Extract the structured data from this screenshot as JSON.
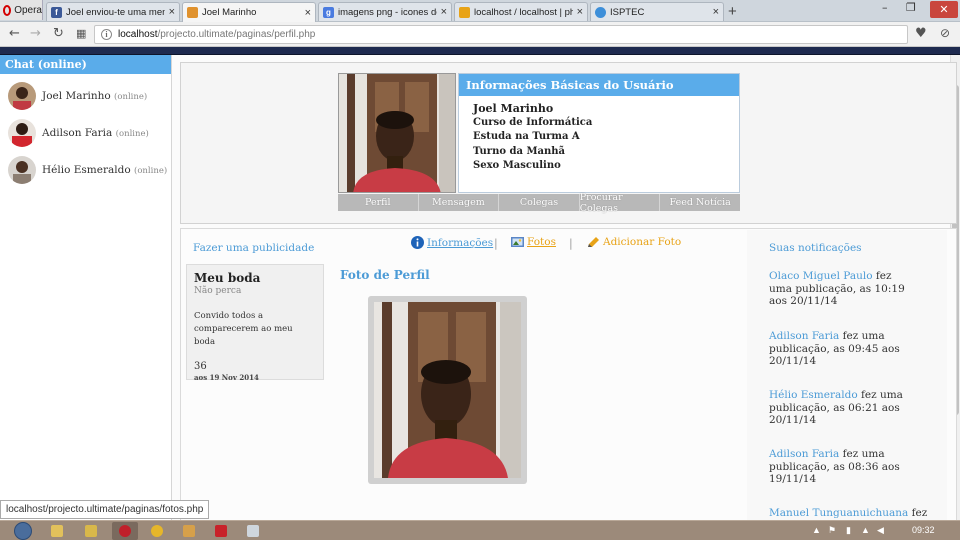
{
  "browser": {
    "menu_label": "Opera",
    "tabs": [
      {
        "label": "Joel enviou-te uma mens",
        "icon": "facebook-icon",
        "color": "#3b5998",
        "active": false
      },
      {
        "label": "Joel Marinho",
        "icon": "site-icon",
        "color": "#e0922e",
        "active": true
      },
      {
        "label": "imagens png - icones de",
        "icon": "google-icon",
        "color": "#4a7be0",
        "active": false
      },
      {
        "label": "localhost / localhost | php",
        "icon": "phpmyadmin-icon",
        "color": "#e8a317",
        "active": false
      },
      {
        "label": "ISPTEC",
        "icon": "globe-icon",
        "color": "#3d8fd9",
        "active": false
      }
    ],
    "url_host": "localhost",
    "url_path": "/projecto.ultimate/paginas/perfil.php",
    "status_url": "localhost/projecto.ultimate/paginas/fotos.php"
  },
  "chat": {
    "header": "Chat (online)",
    "users": [
      {
        "name": "Joel Marinho",
        "status": "(online)"
      },
      {
        "name": "Adilson Faria",
        "status": "(online)"
      },
      {
        "name": "Hélio Esmeraldo",
        "status": "(online)"
      }
    ]
  },
  "profile": {
    "info_title": "Informações Básicas do Usuário",
    "name": "Joel Marinho",
    "course": "Curso de Informática",
    "class": "Estuda na Turma A",
    "shift": "Turno da Manhã",
    "sex": "Sexo Masculino",
    "nav": [
      "Perfil",
      "Mensagem",
      "Colegas",
      "Procurar Colegas",
      "Feed Notícia"
    ]
  },
  "publish": {
    "link": "Fazer uma publicidade",
    "card": {
      "title": "Meu boda",
      "subtitle": "Não perca",
      "body": "Convido todos a comparecerem ao meu boda",
      "count": "36",
      "date": "aos 19 Nov 2014"
    }
  },
  "center": {
    "tabs": [
      {
        "label": "Informações",
        "icon": "info-icon",
        "color": "#4c9bd6"
      },
      {
        "label": "Fotos",
        "icon": "photos-icon",
        "color": "#e8a317"
      },
      {
        "label": "Adicionar Foto",
        "icon": "pencil-icon",
        "color": "#e8a317"
      }
    ],
    "photo_heading": "Foto de Perfil"
  },
  "notifications": {
    "header": "Suas notificações",
    "items": [
      {
        "who": "Olaco Miguel Paulo",
        "text": " fez uma publicação, as 10:19 aos 20/11/14"
      },
      {
        "who": "Adilson Faria",
        "text": " fez uma publicação, as 09:45 aos 20/11/14"
      },
      {
        "who": "Hélio Esmeraldo",
        "text": " fez uma publicação, as 06:21 aos 20/11/14"
      },
      {
        "who": "Adilson Faria",
        "text": " fez uma publicação, as 08:36 aos 19/11/14"
      },
      {
        "who": "Manuel Tunguanuichuana",
        "text": " fez"
      }
    ]
  },
  "taskbar": {
    "clock": "09:32"
  }
}
